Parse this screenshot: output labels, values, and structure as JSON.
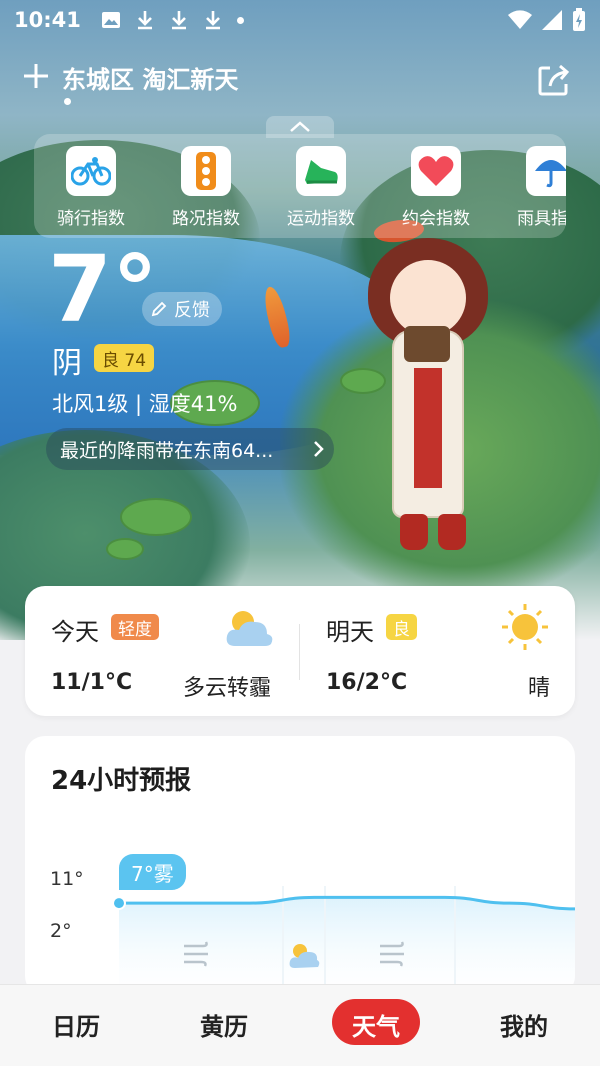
{
  "status_bar": {
    "time": "10:41"
  },
  "header": {
    "location": "东城区  淘汇新天"
  },
  "indices": [
    {
      "label": "骑行指数",
      "icon": "bicycle-icon",
      "color": "#2aa3e8"
    },
    {
      "label": "路况指数",
      "icon": "traffic-light-icon",
      "color": "#f08c1a"
    },
    {
      "label": "运动指数",
      "icon": "running-shoe-icon",
      "color": "#27b35a"
    },
    {
      "label": "约会指数",
      "icon": "heart-icon",
      "color": "#f24b59"
    },
    {
      "label": "雨具指数",
      "icon": "umbrella-icon",
      "color": "#2f7fd6"
    }
  ],
  "current": {
    "temperature": "7°",
    "feedback": "反馈",
    "condition": "阴",
    "aqi": "良 74",
    "wind_humidity": "北风1级 | 湿度41%",
    "rain_notice": "最近的降雨带在东南64..."
  },
  "forecast": {
    "today": {
      "title": "今天",
      "badge": "轻度",
      "temp": "11/1°C",
      "desc": "多云转霾",
      "badge_color": "#f08a4b"
    },
    "tomorrow": {
      "title": "明天",
      "badge": "良",
      "temp": "16/2°C",
      "desc": "晴",
      "badge_color": "#f6d543"
    }
  },
  "hourly": {
    "title": "24小时预报",
    "tooltip": "7°雾",
    "y_high": "11°",
    "y_low": "2°"
  },
  "chart_data": {
    "type": "line",
    "series": [
      {
        "values": [
          7,
          7,
          7,
          8,
          8,
          8,
          7,
          6
        ]
      }
    ],
    "ylim": [
      2,
      11
    ]
  },
  "nav": {
    "items": [
      "日历",
      "黄历",
      "天气",
      "我的"
    ],
    "active_index": 2
  }
}
